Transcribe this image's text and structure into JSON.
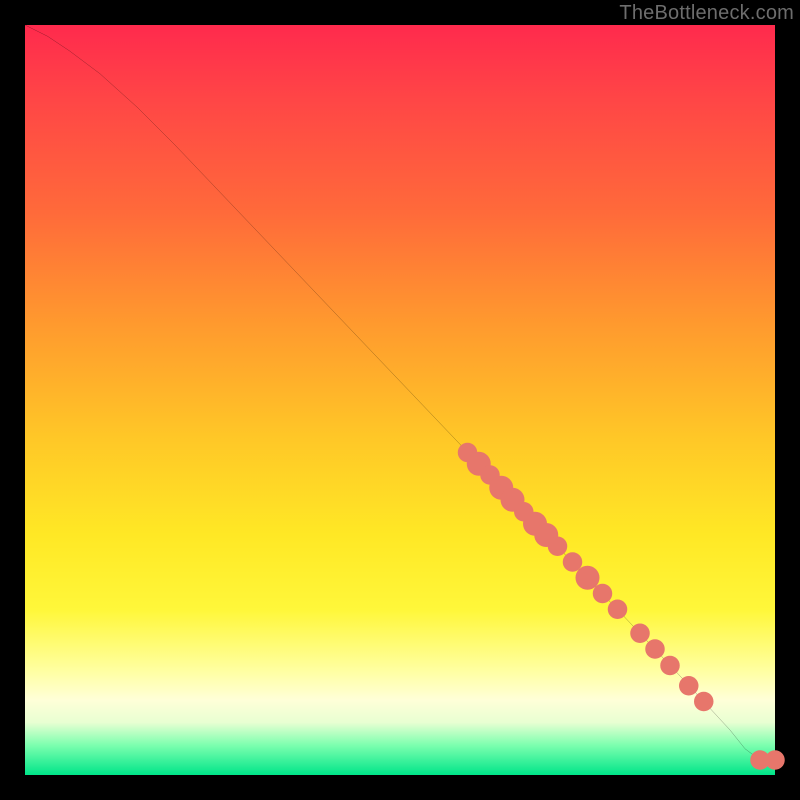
{
  "watermark": "TheBottleneck.com",
  "chart_data": {
    "type": "line",
    "title": "",
    "xlabel": "",
    "ylabel": "",
    "xlim": [
      0,
      100
    ],
    "ylim": [
      0,
      100
    ],
    "series": [
      {
        "name": "curve",
        "x": [
          0,
          3,
          6,
          10,
          15,
          20,
          30,
          40,
          50,
          60,
          70,
          80,
          88,
          94,
          96,
          98,
          100
        ],
        "y": [
          100,
          98.5,
          96.5,
          93.5,
          89,
          84,
          73.5,
          63,
          52.5,
          42,
          31.5,
          21,
          12.5,
          6,
          3.5,
          2,
          2
        ]
      }
    ],
    "markers": [
      {
        "x": 59,
        "y": 43,
        "r": 1.3
      },
      {
        "x": 60.5,
        "y": 41.5,
        "r": 1.6
      },
      {
        "x": 62,
        "y": 40,
        "r": 1.3
      },
      {
        "x": 63.5,
        "y": 38.3,
        "r": 1.6
      },
      {
        "x": 65,
        "y": 36.7,
        "r": 1.6
      },
      {
        "x": 66.5,
        "y": 35.1,
        "r": 1.3
      },
      {
        "x": 68,
        "y": 33.5,
        "r": 1.6
      },
      {
        "x": 69.5,
        "y": 32,
        "r": 1.6
      },
      {
        "x": 71,
        "y": 30.5,
        "r": 1.3
      },
      {
        "x": 73,
        "y": 28.4,
        "r": 1.3
      },
      {
        "x": 75,
        "y": 26.3,
        "r": 1.6
      },
      {
        "x": 77,
        "y": 24.2,
        "r": 1.3
      },
      {
        "x": 79,
        "y": 22.1,
        "r": 1.3
      },
      {
        "x": 82,
        "y": 18.9,
        "r": 1.3
      },
      {
        "x": 84,
        "y": 16.8,
        "r": 1.3
      },
      {
        "x": 86,
        "y": 14.6,
        "r": 1.3
      },
      {
        "x": 88.5,
        "y": 11.9,
        "r": 1.3
      },
      {
        "x": 90.5,
        "y": 9.8,
        "r": 1.3
      },
      {
        "x": 98,
        "y": 2,
        "r": 1.3
      },
      {
        "x": 100,
        "y": 2,
        "r": 1.3
      }
    ],
    "colors": {
      "curve": "#000000",
      "marker": "#e7766b"
    }
  }
}
